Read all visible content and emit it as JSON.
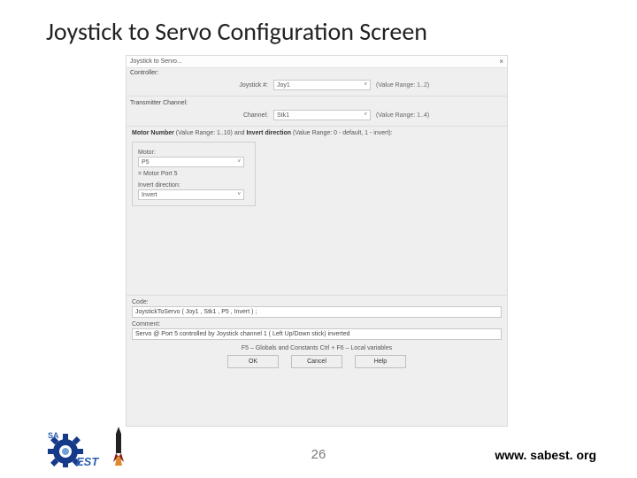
{
  "slide": {
    "title": "Joystick to Servo Configuration Screen",
    "page_number": "26",
    "url": "www. sabest. org"
  },
  "window": {
    "title": "Joystick to Servo...",
    "close": "×",
    "controller_label": "Controller:",
    "joystick_label": "Joystick #:",
    "joystick_value": "Joy1",
    "joystick_hint": "(Value Range: 1..2)",
    "tx_label": "Transmitter Channel:",
    "channel_label": "Channel:",
    "channel_value": "Stk1",
    "channel_hint": "(Value Range: 1..4)",
    "motor_header": "Motor Number (Value Range: 1..10) and Invert direction (Value Range: 0 - default, 1 - invert):",
    "motor_label": "Motor:",
    "motor_value": "P5",
    "motor_port_label": "= Motor Port 5",
    "invert_label": "Invert direction:",
    "invert_value": "Invert",
    "code_label": "Code:",
    "code_text": "JoystickToServo ( Joy1 , Stk1 , P5 , Invert ) ;",
    "comment_label": "Comment:",
    "comment_text": "Servo @ Port 5 controlled by Joystick channel 1 ( Left Up/Down stick) inverted",
    "hint_keys": "F5 – Globals and Constants       Ctrl + F6 – Local variables",
    "btn_ok": "OK",
    "btn_cancel": "Cancel",
    "btn_help": "Help"
  }
}
